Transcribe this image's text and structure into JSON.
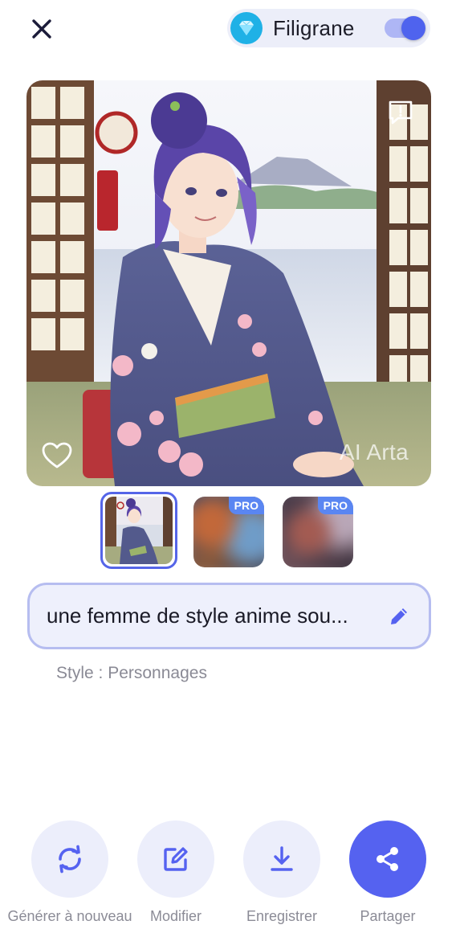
{
  "header": {
    "watermark_label": "Filigrane",
    "watermark_enabled": true
  },
  "image": {
    "watermark_text": "AI Arta",
    "liked": false
  },
  "thumbnails": [
    {
      "selected": true,
      "pro": false,
      "badge": ""
    },
    {
      "selected": false,
      "pro": true,
      "badge": "PRO"
    },
    {
      "selected": false,
      "pro": true,
      "badge": "PRO"
    }
  ],
  "prompt": {
    "text": "une femme de style anime sou..."
  },
  "style_line": "Style : Personnages",
  "actions": [
    {
      "label": "Générer à nouveau",
      "icon": "regenerate-icon"
    },
    {
      "label": "Modifier",
      "icon": "edit-icon"
    },
    {
      "label": "Enregistrer",
      "icon": "download-icon"
    },
    {
      "label": "Partager",
      "icon": "share-icon"
    }
  ],
  "colors": {
    "accent": "#5562f0",
    "accent_light": "#eceefb",
    "prompt_border": "#b6bdf0",
    "pro_badge": "#5a86f2"
  }
}
